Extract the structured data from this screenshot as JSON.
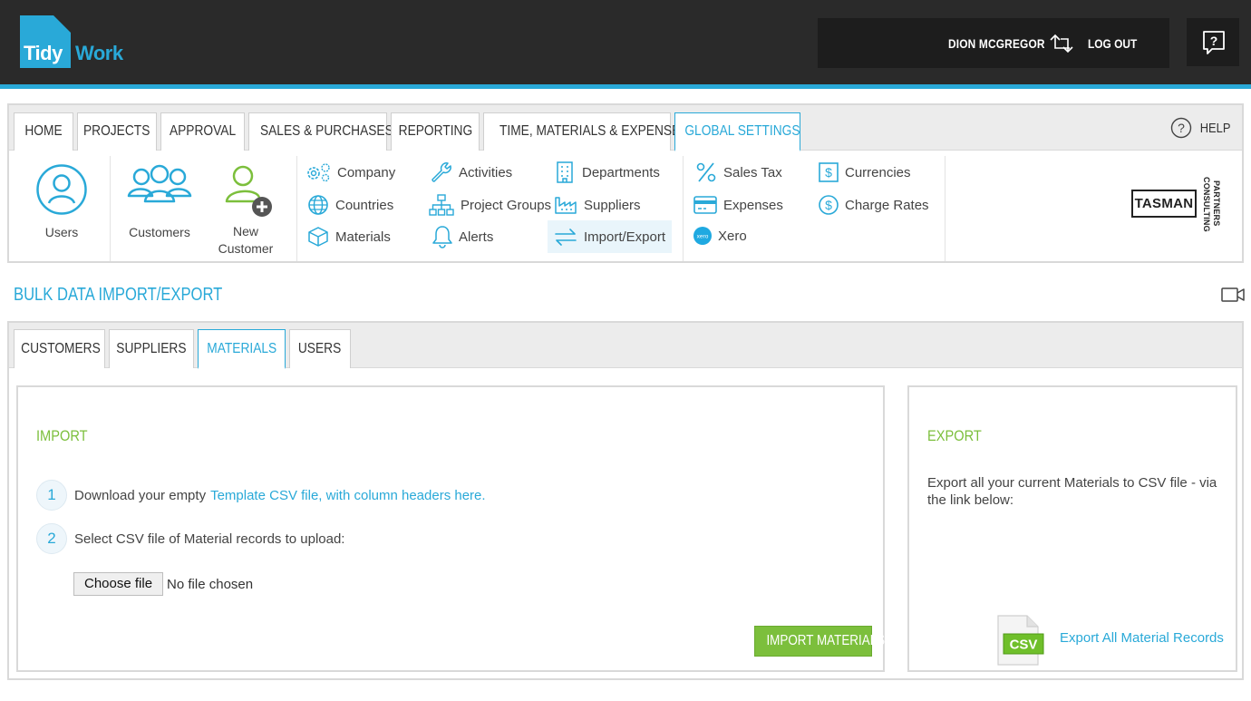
{
  "brand": {
    "logo_left": "Tidy",
    "logo_right": "Work",
    "accent": "#29a9d8",
    "green": "#7cbf3c"
  },
  "header": {
    "user_name": "DION MCGREGOR",
    "logout_label": "LOG OUT",
    "help_icon": "question-box-icon"
  },
  "nav": {
    "tabs": [
      {
        "label": "HOME"
      },
      {
        "label": "PROJECTS"
      },
      {
        "label": "APPROVAL"
      },
      {
        "label": "SALES & PURCHASES"
      },
      {
        "label": "REPORTING"
      },
      {
        "label": "TIME, MATERIALS & EXPENSES"
      },
      {
        "label": "GLOBAL SETTINGS"
      }
    ],
    "active_tab": "GLOBAL SETTINGS",
    "help_label": "HELP",
    "big_items": [
      {
        "label": "Users",
        "icon": "user-circle-icon"
      },
      {
        "label": "Customers",
        "icon": "user-group-icon"
      },
      {
        "label": "New Customer",
        "label_line1": "New",
        "label_line2": "Customer",
        "icon": "add-user-icon"
      }
    ],
    "settings": [
      {
        "label": "Company",
        "icon": "cogs-icon"
      },
      {
        "label": "Countries",
        "icon": "globe-icon"
      },
      {
        "label": "Materials",
        "icon": "cube-icon"
      },
      {
        "label": "Activities",
        "icon": "wrench-icon"
      },
      {
        "label": "Project Groups",
        "icon": "hierarchy-icon"
      },
      {
        "label": "Alerts",
        "icon": "bell-icon"
      },
      {
        "label": "Departments",
        "icon": "building-icon"
      },
      {
        "label": "Suppliers",
        "icon": "factory-icon"
      },
      {
        "label": "Import/Export",
        "icon": "arrows-exchange-icon"
      },
      {
        "label": "Sales Tax",
        "icon": "percent-icon"
      },
      {
        "label": "Expenses",
        "icon": "credit-card-icon"
      },
      {
        "label": "Xero",
        "icon": "xero-icon"
      },
      {
        "label": "Currencies",
        "icon": "dollar-box-icon"
      },
      {
        "label": "Charge Rates",
        "icon": "dollar-circle-icon"
      }
    ],
    "partner": {
      "name": "TASMAN",
      "line1": "CONSULTING",
      "line2": "PARTNERS"
    }
  },
  "page": {
    "title": "BULK DATA IMPORT/EXPORT",
    "video_icon": "video-camera-icon"
  },
  "content": {
    "tabs": [
      {
        "label": "CUSTOMERS"
      },
      {
        "label": "SUPPLIERS"
      },
      {
        "label": "MATERIALS"
      },
      {
        "label": "USERS"
      }
    ],
    "active_tab": "MATERIALS",
    "import": {
      "heading": "IMPORT",
      "step1_num": "1",
      "step1_text": "Download your empty",
      "step1_link": "Template CSV file, with column headers here.",
      "step2_num": "2",
      "step2_text": "Select CSV file of Material records to upload:",
      "file_button": "Choose file",
      "file_status": "No file chosen",
      "submit_label": "IMPORT MATERIALS"
    },
    "export": {
      "heading": "EXPORT",
      "description": "Export all your current Materials to CSV file - via the link below:",
      "csv_badge": "CSV",
      "link_label": "Export All Material Records"
    }
  }
}
